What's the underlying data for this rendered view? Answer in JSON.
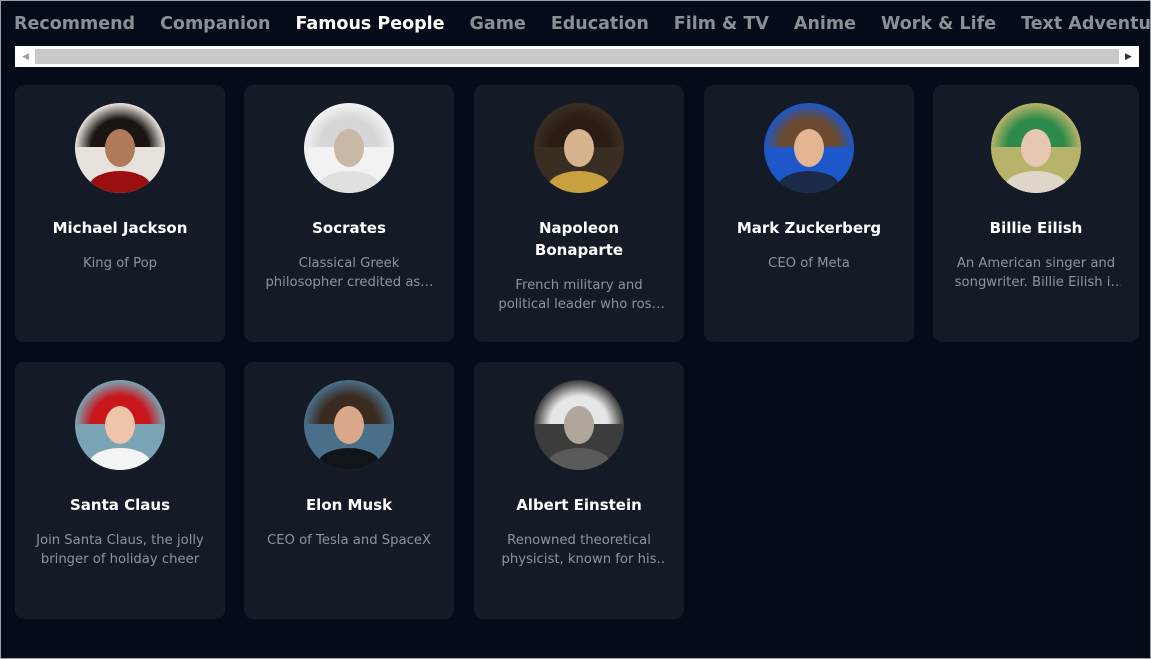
{
  "tabs": [
    {
      "label": "Recommend",
      "active": false
    },
    {
      "label": "Companion",
      "active": false
    },
    {
      "label": "Famous People",
      "active": true
    },
    {
      "label": "Game",
      "active": false
    },
    {
      "label": "Education",
      "active": false
    },
    {
      "label": "Film & TV",
      "active": false
    },
    {
      "label": "Anime",
      "active": false
    },
    {
      "label": "Work & Life",
      "active": false
    },
    {
      "label": "Text Adventure",
      "active": false
    }
  ],
  "scrollbar": {
    "left_arrow": "◀",
    "right_arrow": "▶"
  },
  "characters": [
    {
      "name": "Michael Jackson",
      "desc": "King of Pop",
      "bg": "#e8e2dc",
      "hair": "#1a1412",
      "skin": "#b07a5a",
      "body": "#9a1010"
    },
    {
      "name": "Socrates",
      "desc": "Classical Greek philosopher credited as a founder of Western philosophy",
      "bg": "#f2f2f2",
      "hair": "#d6d6d6",
      "skin": "#c9b8a6",
      "body": "#e0e0e0"
    },
    {
      "name": "Napoleon Bonaparte",
      "desc": "French military and political leader who rose to prominence",
      "bg": "#3a2d22",
      "hair": "#2a1c12",
      "skin": "#d7b48e",
      "body": "#c8a040"
    },
    {
      "name": "Mark Zuckerberg",
      "desc": "CEO of Meta",
      "bg": "#1d57c9",
      "hair": "#6b4a30",
      "skin": "#e3b592",
      "body": "#1c2a4a"
    },
    {
      "name": "Billie Eilish",
      "desc": "An American singer and songwriter. Billie Eilish is known for her music",
      "bg": "#b7b36a",
      "hair": "#2e8a4a",
      "skin": "#e6c7b0",
      "body": "#ded6c8"
    },
    {
      "name": "Santa Claus",
      "desc": "Join Santa Claus, the jolly bringer of holiday cheer",
      "bg": "#7aa3b3",
      "hair": "#c8161b",
      "skin": "#f0c4a8",
      "body": "#f4f4f4"
    },
    {
      "name": "Elon Musk",
      "desc": "CEO of Tesla and SpaceX",
      "bg": "#4a6f8a",
      "hair": "#3a2a20",
      "skin": "#d9a98a",
      "body": "#111418"
    },
    {
      "name": "Albert Einstein",
      "desc": "Renowned theoretical physicist, known for his theory of relativity",
      "bg": "#3c3c3c",
      "hair": "#e6e6e6",
      "skin": "#b0a69c",
      "body": "#5a5a5a"
    }
  ]
}
